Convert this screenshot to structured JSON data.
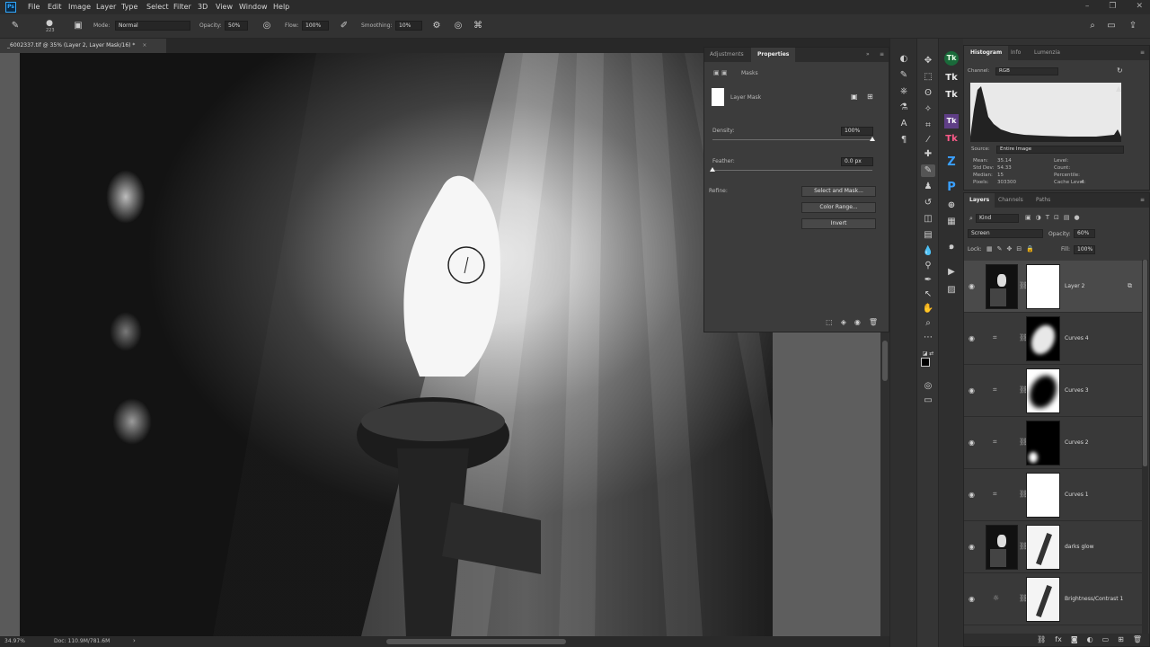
{
  "app": {
    "logo_text": "Ps"
  },
  "menu": [
    "File",
    "Edit",
    "Image",
    "Layer",
    "Type",
    "Select",
    "Filter",
    "3D",
    "View",
    "Window",
    "Help"
  ],
  "options_bar": {
    "brush_size": "223",
    "mode_label": "Mode:",
    "mode_value": "Normal",
    "opacity_label": "Opacity:",
    "opacity_value": "50%",
    "flow_label": "Flow:",
    "flow_value": "100%",
    "smoothing_label": "Smoothing:",
    "smoothing_value": "10%"
  },
  "document": {
    "tab_title": "_6002337.tif @ 35% (Layer 2, Layer Mask/16) *",
    "close_glyph": "×"
  },
  "status": {
    "zoom": "34.97%",
    "doc_size": "Doc: 110.9M/781.6M"
  },
  "properties": {
    "tab_adjustments": "Adjustments",
    "tab_properties": "Properties",
    "section": "Masks",
    "mask_type": "Layer Mask",
    "density_label": "Density:",
    "density_value": "100%",
    "density_level": 1.0,
    "feather_label": "Feather:",
    "feather_value": "0.0 px",
    "feather_level": 0.0,
    "refine_label": "Refine:",
    "btn_select_mask": "Select and Mask...",
    "btn_color_range": "Color Range...",
    "btn_invert": "Invert"
  },
  "histogram": {
    "tab_histogram": "Histogram",
    "tab_info": "Info",
    "tab_lumenzia": "Lumenzia",
    "channel_label": "Channel:",
    "channel_value": "RGB",
    "source_label": "Source:",
    "source_value": "Entire Image",
    "stats_left": [
      {
        "label": "Mean:",
        "value": "35.14"
      },
      {
        "label": "Std Dev:",
        "value": "54.33"
      },
      {
        "label": "Median:",
        "value": "15"
      },
      {
        "label": "Pixels:",
        "value": "303300"
      }
    ],
    "stats_right": [
      {
        "label": "Level:",
        "value": ""
      },
      {
        "label": "Count:",
        "value": ""
      },
      {
        "label": "Percentile:",
        "value": ""
      },
      {
        "label": "Cache Level:",
        "value": "4"
      }
    ]
  },
  "layers_panel": {
    "tab_layers": "Layers",
    "tab_channels": "Channels",
    "tab_paths": "Paths",
    "filter_value": "Kind",
    "blend_mode": "Screen",
    "opacity_label": "Opacity:",
    "opacity_value": "60%",
    "lock_label": "Lock:",
    "fill_label": "Fill:",
    "fill_value": "100%",
    "layers": [
      {
        "name": "Layer 2",
        "type": "pixel",
        "mask": "white",
        "active": true
      },
      {
        "name": "Curves 4",
        "type": "curves",
        "mask": "blob-light"
      },
      {
        "name": "Curves 3",
        "type": "curves",
        "mask": "blob-dark"
      },
      {
        "name": "Curves 2",
        "type": "curves",
        "mask": "black"
      },
      {
        "name": "Curves 1",
        "type": "curves",
        "mask": "white"
      },
      {
        "name": "darks glow",
        "type": "pixel",
        "mask": "sketch"
      },
      {
        "name": "Brightness/Contrast 1",
        "type": "brightness",
        "mask": "sketch"
      }
    ]
  }
}
